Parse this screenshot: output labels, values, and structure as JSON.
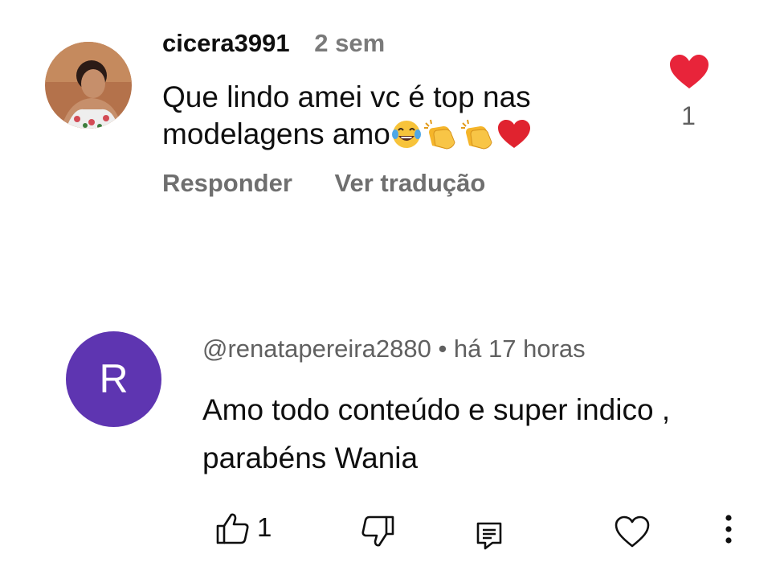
{
  "comment1": {
    "username": "cicera3991",
    "time": "2 sem",
    "text": "Que lindo amei vc é top  nas modelagens amo",
    "emojis": [
      "face-with-tears-of-joy",
      "clapping-hands",
      "clapping-hands",
      "red-heart"
    ],
    "reply_label": "Responder",
    "translate_label": "Ver tradução",
    "like_count": "1",
    "like_icon": "filled-heart-icon",
    "colors": {
      "heart": "#e8243a"
    }
  },
  "comment2": {
    "avatar_letter": "R",
    "header": "@renatapereira2880 • há 17 horas",
    "text": "Amo todo conteúdo e super indico , parabéns Wania",
    "like_count": "1",
    "icons": [
      "thumbs-up-icon",
      "thumbs-down-icon",
      "reply-icon",
      "heart-outline-icon",
      "more-vert-icon"
    ],
    "colors": {
      "avatar_bg": "#5e35b1"
    }
  }
}
